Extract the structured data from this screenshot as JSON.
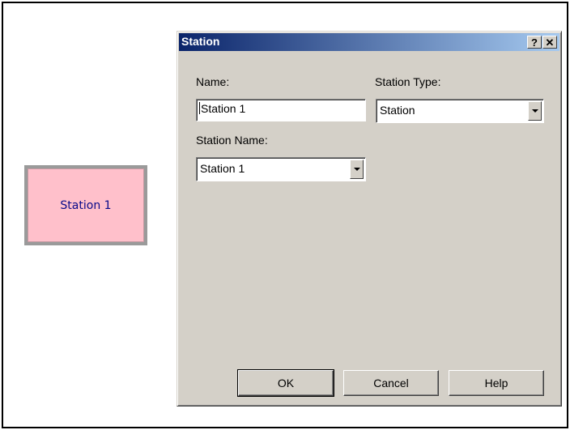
{
  "canvas": {
    "module": {
      "label": "Station 1",
      "fill_color": "#ffc0cb",
      "text_color": "#0a0a8a"
    }
  },
  "dialog": {
    "title": "Station",
    "title_buttons": {
      "help": "?",
      "close": "✕"
    },
    "fields": {
      "name": {
        "label": "Name:",
        "value": "Station 1"
      },
      "station_type": {
        "label": "Station Type:",
        "value": "Station"
      },
      "station_name": {
        "label": "Station Name:",
        "value": "Station 1"
      }
    },
    "buttons": {
      "ok": "OK",
      "cancel": "Cancel",
      "help": "Help"
    },
    "colors": {
      "face": "#d4d0c8",
      "title_start": "#0a246a",
      "title_end": "#a6caf0"
    }
  }
}
